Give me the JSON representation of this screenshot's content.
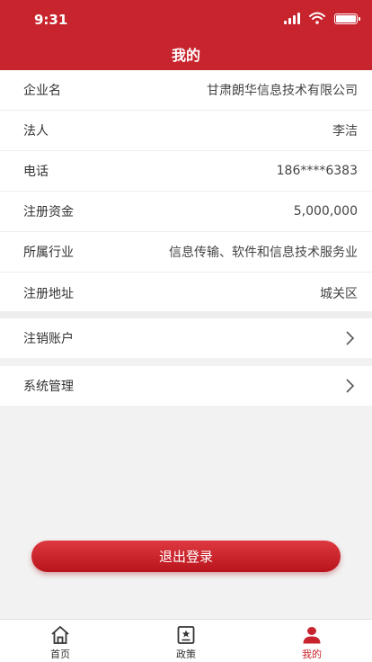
{
  "status_bar": {
    "time": "9:31"
  },
  "header": {
    "title": "我的"
  },
  "info": [
    {
      "label": "企业名",
      "value": "甘肃朗华信息技术有限公司"
    },
    {
      "label": "法人",
      "value": "李洁"
    },
    {
      "label": "电话",
      "value": "186****6383"
    },
    {
      "label": "注册资金",
      "value": "5,000,000"
    },
    {
      "label": "所属行业",
      "value": "信息传输、软件和信息技术服务业"
    },
    {
      "label": "注册地址",
      "value": "城关区"
    }
  ],
  "actions": {
    "cancel_account": "注销账户",
    "system_management": "系统管理"
  },
  "logout_button": "退出登录",
  "tabbar": {
    "home": "首页",
    "policy": "政策",
    "mine": "我的"
  },
  "colors": {
    "brand": "#c8242d",
    "background": "#f2f2f2"
  },
  "icons": [
    "home-icon",
    "policy-icon",
    "user-icon",
    "chevron-right-icon",
    "signal-icon",
    "wifi-icon",
    "battery-icon"
  ]
}
